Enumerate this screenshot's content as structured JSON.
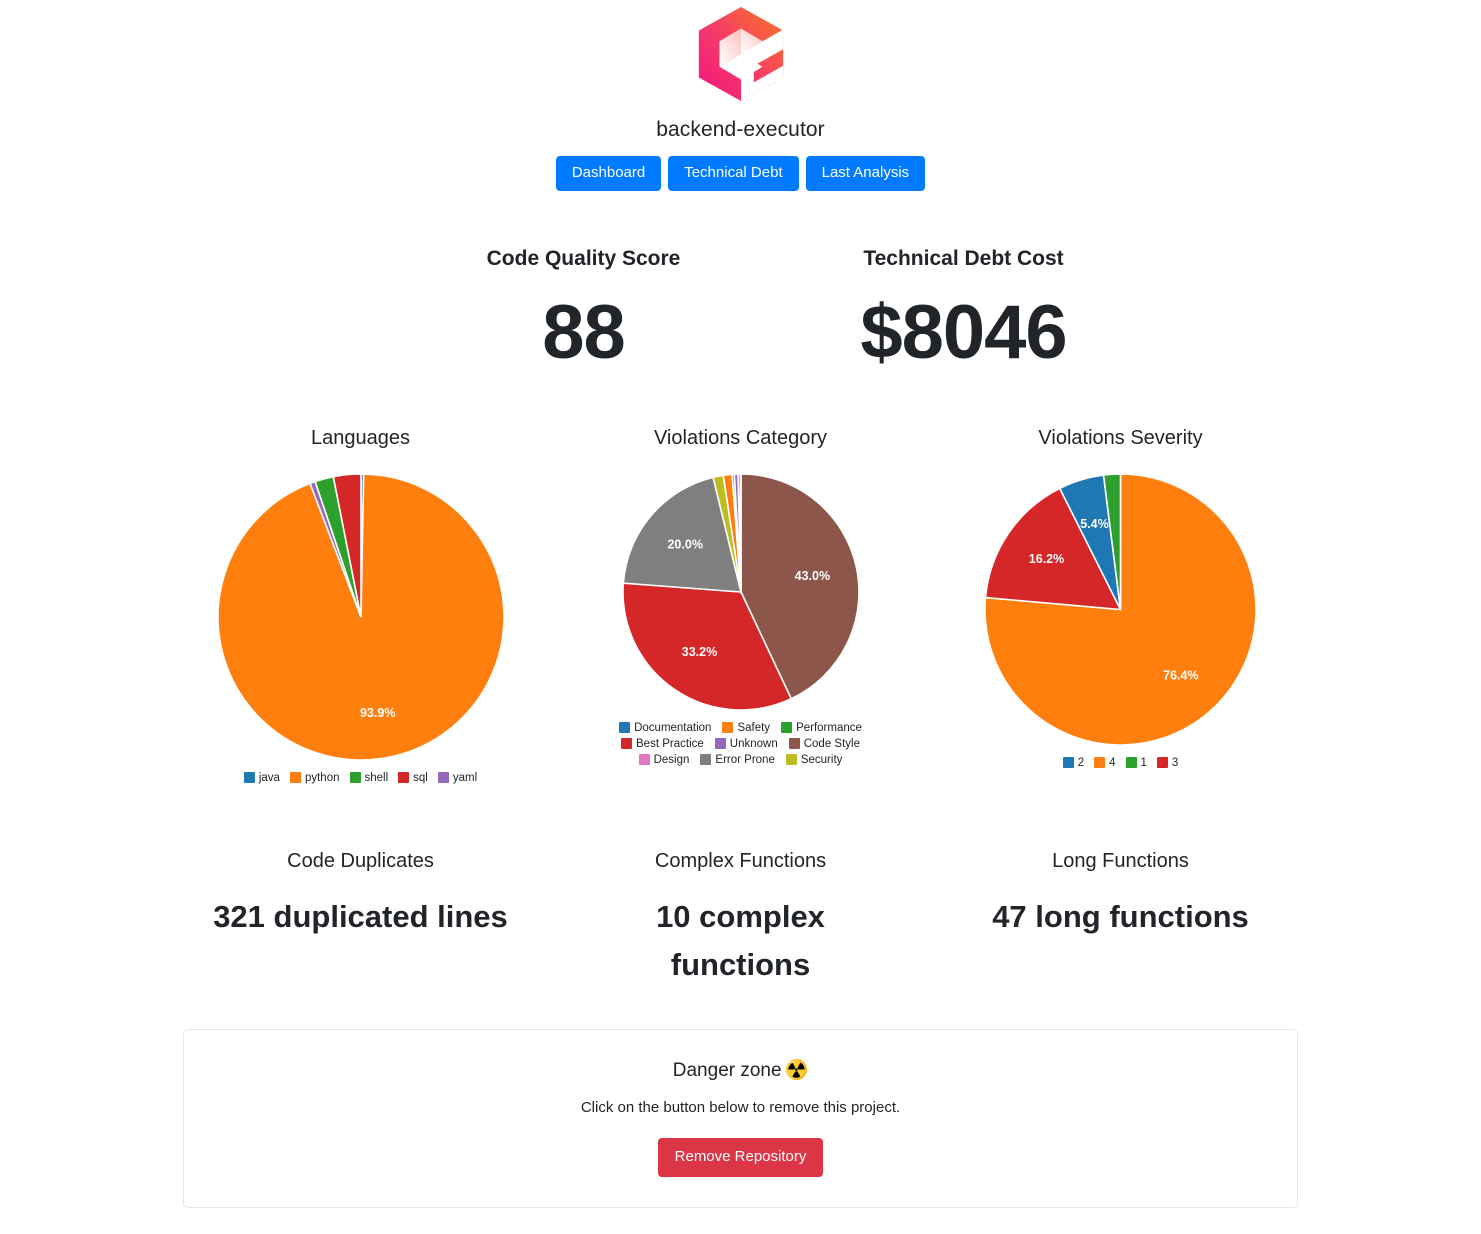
{
  "header": {
    "logo_name": "codacy-hexagon-c-logo",
    "project_title": "backend-executor",
    "nav": [
      {
        "label": "Dashboard"
      },
      {
        "label": "Technical Debt"
      },
      {
        "label": "Last Analysis"
      }
    ]
  },
  "scores": [
    {
      "label": "Code Quality Score",
      "value": "88"
    },
    {
      "label": "Technical Debt Cost",
      "value": "$8046"
    }
  ],
  "chart_data": [
    {
      "type": "pie",
      "title": "Languages",
      "categories": [
        "java",
        "python",
        "shell",
        "sql",
        "yaml"
      ],
      "values": [
        0.3,
        93.9,
        2.1,
        3.1,
        0.6
      ],
      "labels_shown": [
        "",
        "93.9%",
        "",
        "",
        ""
      ],
      "colors": [
        "#1f77b4",
        "#ff7f0e",
        "#2ca02c",
        "#d62728",
        "#9467bd"
      ],
      "legend_position": "bottom",
      "slice_order_clockwise_from_top": [
        "java",
        "python",
        "yaml",
        "shell",
        "sql"
      ]
    },
    {
      "type": "pie",
      "title": "Violations Category",
      "categories": [
        "Documentation",
        "Safety",
        "Performance",
        "Best Practice",
        "Unknown",
        "Code Style",
        "Design",
        "Error Prone",
        "Security"
      ],
      "values": [
        0.3,
        1.2,
        0.3,
        33.2,
        0.5,
        43.0,
        0.1,
        20.0,
        1.4
      ],
      "labels_shown": [
        "",
        "",
        "",
        "33.2%",
        "",
        "43.0%",
        "",
        "20.0%",
        ""
      ],
      "colors": [
        "#1f77b4",
        "#ff7f0e",
        "#2ca02c",
        "#d62728",
        "#9467bd",
        "#8c564b",
        "#e377c2",
        "#7f7f7f",
        "#bcbd22"
      ],
      "legend_position": "bottom",
      "slice_order_clockwise_from_top": [
        "Code Style",
        "Best Practice",
        "Error Prone",
        "Security",
        "Safety",
        "Performance",
        "Unknown",
        "Documentation",
        "Design"
      ]
    },
    {
      "type": "pie",
      "title": "Violations Severity",
      "categories": [
        "2",
        "4",
        "1",
        "3"
      ],
      "values": [
        5.4,
        76.4,
        2.0,
        16.2
      ],
      "labels_shown": [
        "5.4%",
        "76.4%",
        "",
        "16.2%"
      ],
      "colors": [
        "#1f77b4",
        "#ff7f0e",
        "#2ca02c",
        "#d62728"
      ],
      "legend_position": "bottom",
      "slice_order_clockwise_from_top": [
        "4",
        "3",
        "2",
        "1"
      ]
    }
  ],
  "metrics": [
    {
      "label": "Code Duplicates",
      "value": "321 duplicated lines"
    },
    {
      "label": "Complex Functions",
      "value": "10 complex functions"
    },
    {
      "label": "Long Functions",
      "value": "47 long functions"
    }
  ],
  "danger_zone": {
    "title": "Danger zone",
    "emoji": "☢️",
    "emoji_name": "radioactive-sign",
    "subtitle": "Click on the button below to remove this project.",
    "button_label": "Remove Repository",
    "button_color": "#dc3545"
  },
  "theme": {
    "accent": "#007bff",
    "danger": "#dc3545",
    "text": "#212529",
    "background": "#ffffff",
    "card_border": "#e4e6e8"
  }
}
